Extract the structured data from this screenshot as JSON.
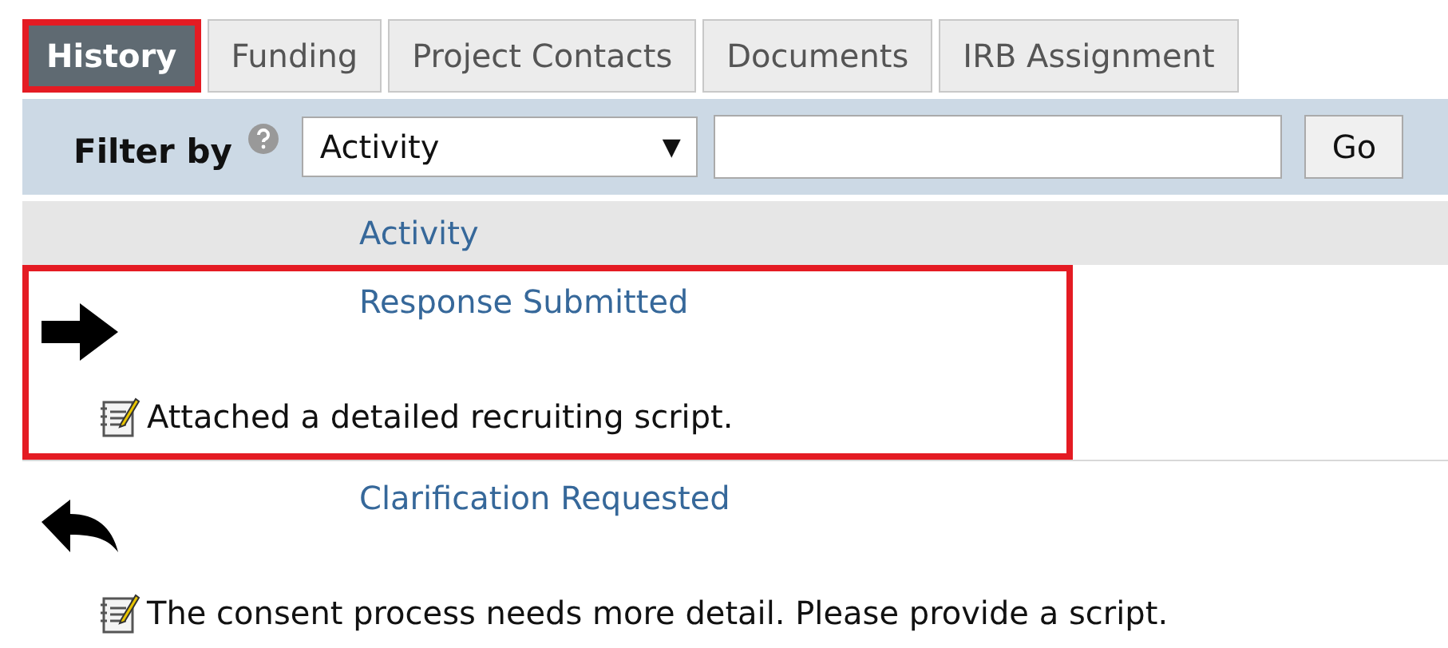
{
  "tabs": [
    {
      "label": "History",
      "selected": true,
      "highlighted": true
    },
    {
      "label": "Funding",
      "selected": false,
      "highlighted": false
    },
    {
      "label": "Project Contacts",
      "selected": false,
      "highlighted": false
    },
    {
      "label": "Documents",
      "selected": false,
      "highlighted": false
    },
    {
      "label": "IRB Assignment",
      "selected": false,
      "highlighted": false
    }
  ],
  "filter": {
    "label": "Filter by",
    "select_value": "Activity",
    "select_caret": "▼",
    "button": "Go"
  },
  "table": {
    "column": "Activity",
    "rows": [
      {
        "kind": "forward",
        "title": "Response Submitted",
        "note": "Attached a detailed recruiting script.",
        "highlighted": true
      },
      {
        "kind": "reply",
        "title": "Clarification Requested",
        "note": "The consent process needs more detail. Please provide a script.",
        "highlighted": false
      }
    ]
  }
}
